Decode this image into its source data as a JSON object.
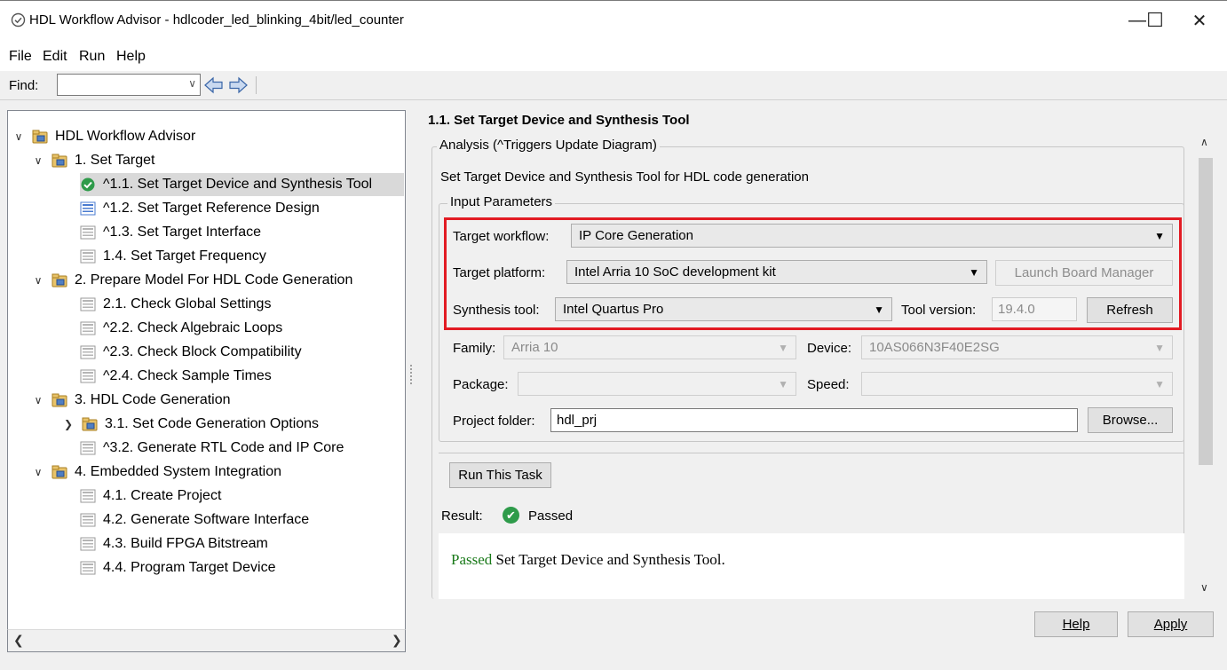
{
  "window": {
    "title": "HDL Workflow Advisor - hdlcoder_led_blinking_4bit/led_counter",
    "minimize": "—",
    "maximize": "☐",
    "close": "✕"
  },
  "menu": [
    "File",
    "Edit",
    "Run",
    "Help"
  ],
  "find": {
    "label": "Find:",
    "value": ""
  },
  "tree": [
    {
      "label": "HDL Workflow Advisor",
      "level": 0,
      "expand": "open",
      "icon": "folder-icon"
    },
    {
      "label": "1. Set Target",
      "level": 1,
      "expand": "open",
      "icon": "folder-icon"
    },
    {
      "label": "^1.1. Set Target Device and Synthesis Tool",
      "level": 2,
      "expand": "none",
      "icon": "passed-check-icon",
      "selected": true
    },
    {
      "label": "^1.2. Set Target Reference Design",
      "level": 2,
      "expand": "none",
      "icon": "task-icon-blue"
    },
    {
      "label": "^1.3. Set Target Interface",
      "level": 2,
      "expand": "none",
      "icon": "task-icon"
    },
    {
      "label": "1.4. Set Target Frequency",
      "level": 2,
      "expand": "none",
      "icon": "task-icon"
    },
    {
      "label": "2. Prepare Model For HDL Code Generation",
      "level": 1,
      "expand": "open",
      "icon": "folder-icon"
    },
    {
      "label": "2.1. Check Global Settings",
      "level": 2,
      "expand": "none",
      "icon": "task-icon"
    },
    {
      "label": "^2.2. Check Algebraic Loops",
      "level": 2,
      "expand": "none",
      "icon": "task-icon"
    },
    {
      "label": "^2.3. Check Block Compatibility",
      "level": 2,
      "expand": "none",
      "icon": "task-icon"
    },
    {
      "label": "^2.4. Check Sample Times",
      "level": 2,
      "expand": "none",
      "icon": "task-icon"
    },
    {
      "label": "3. HDL Code Generation",
      "level": 1,
      "expand": "open",
      "icon": "folder-icon"
    },
    {
      "label": "3.1. Set Code Generation Options",
      "level": 2,
      "expand": "closed",
      "icon": "folder-icon"
    },
    {
      "label": "^3.2. Generate RTL Code and IP Core",
      "level": 2,
      "expand": "none",
      "icon": "task-icon"
    },
    {
      "label": "4. Embedded System Integration",
      "level": 1,
      "expand": "open",
      "icon": "folder-icon"
    },
    {
      "label": "4.1. Create Project",
      "level": 2,
      "expand": "none",
      "icon": "task-icon"
    },
    {
      "label": "4.2. Generate Software Interface",
      "level": 2,
      "expand": "none",
      "icon": "task-icon"
    },
    {
      "label": "4.3. Build FPGA Bitstream",
      "level": 2,
      "expand": "none",
      "icon": "task-icon"
    },
    {
      "label": "4.4. Program Target Device",
      "level": 2,
      "expand": "none",
      "icon": "task-icon"
    }
  ],
  "panel": {
    "title": "1.1. Set Target Device and Synthesis Tool",
    "analysis_label": "Analysis (^Triggers Update Diagram)",
    "description": "Set Target Device and Synthesis Tool for HDL code generation",
    "input_params_label": "Input Parameters",
    "target_workflow": {
      "label": "Target workflow:",
      "value": "IP Core Generation"
    },
    "target_platform": {
      "label": "Target platform:",
      "value": "Intel Arria 10 SoC development kit"
    },
    "launch_board_manager": "Launch Board Manager",
    "synthesis_tool": {
      "label": "Synthesis tool:",
      "value": "Intel Quartus Pro"
    },
    "tool_version": {
      "label": "Tool version:",
      "value": "19.4.0"
    },
    "refresh": "Refresh",
    "family": {
      "label": "Family:",
      "value": "Arria 10"
    },
    "device": {
      "label": "Device:",
      "value": "10AS066N3F40E2SG"
    },
    "package": {
      "label": "Package:",
      "value": ""
    },
    "speed": {
      "label": "Speed:",
      "value": ""
    },
    "project_folder": {
      "label": "Project folder:",
      "value": "hdl_prj"
    },
    "browse": "Browse...",
    "run_task": "Run This Task",
    "result_label": "Result:",
    "result_status": "Passed",
    "result_message_status": "Passed",
    "result_message_text": "Set Target Device and Synthesis Tool."
  },
  "footer": {
    "help": "Help",
    "apply": "Apply"
  },
  "colors": {
    "highlight": "#e21b23",
    "passed_green": "#2e9b4a"
  }
}
